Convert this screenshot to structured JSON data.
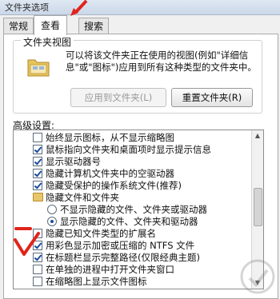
{
  "window": {
    "title": "文件夹选项"
  },
  "tabs": [
    {
      "label": "常规",
      "active": false
    },
    {
      "label": "查看",
      "active": true
    },
    {
      "label": "搜索",
      "active": false
    }
  ],
  "folder_views": {
    "group_title": "文件夹视图",
    "description": "可以将该文件夹正在使用的视图(例如\"详细信息\"或\"图标\")应用到所有这种类型的文件夹中。",
    "apply_button": "应用到文件夹(L)",
    "reset_button": "重置文件夹(R)"
  },
  "advanced": {
    "label": "高级设置:",
    "items": [
      {
        "kind": "checkbox",
        "checked": false,
        "text": "始终显示图标，从不显示缩略图"
      },
      {
        "kind": "checkbox",
        "checked": true,
        "text": "鼠标指向文件夹和桌面项时显示提示信息"
      },
      {
        "kind": "checkbox",
        "checked": true,
        "text": "显示驱动器号"
      },
      {
        "kind": "checkbox",
        "checked": true,
        "text": "隐藏计算机文件夹中的空驱动器"
      },
      {
        "kind": "checkbox",
        "checked": true,
        "text": "隐藏受保护的操作系统文件(推荐)"
      },
      {
        "kind": "folder",
        "text": "隐藏文件和文件夹"
      },
      {
        "kind": "radio",
        "selected": false,
        "text": "不显示隐藏的文件、文件夹或驱动器"
      },
      {
        "kind": "radio",
        "selected": true,
        "text": "显示隐藏的文件、文件夹和驱动器"
      },
      {
        "kind": "checkbox",
        "checked": false,
        "text": "隐藏已知文件类型的扩展名"
      },
      {
        "kind": "checkbox",
        "checked": true,
        "text": "用彩色显示加密或压缩的 NTFS 文件"
      },
      {
        "kind": "checkbox",
        "checked": true,
        "text": "在标题栏显示完整路径(仅限经典主题)"
      },
      {
        "kind": "checkbox",
        "checked": false,
        "text": "在单独的进程中打开文件夹窗口"
      },
      {
        "kind": "checkbox",
        "checked": false,
        "text": "在缩略图上显示文件图标"
      }
    ]
  },
  "colors": {
    "annotation": "#e0241b",
    "checkmark": "#1a4f9c"
  }
}
